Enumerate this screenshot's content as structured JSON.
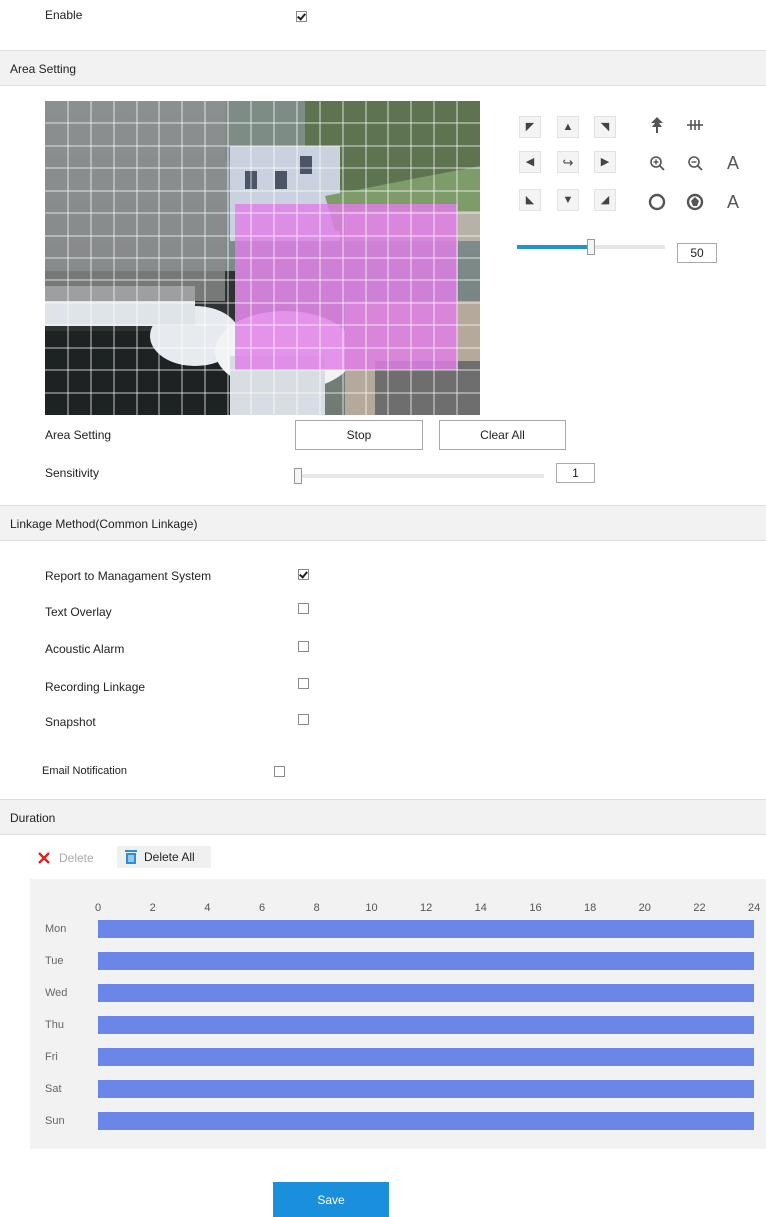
{
  "enable": {
    "label": "Enable",
    "checked": true
  },
  "area_section": {
    "title": "Area Setting"
  },
  "ptz": {
    "icons": [
      "arrow-up-left-icon",
      "arrow-up-icon",
      "arrow-up-right-icon",
      "arrow-left-icon",
      "rotate-icon",
      "arrow-right-icon",
      "arrow-down-left-icon",
      "arrow-down-icon",
      "arrow-down-right-icon",
      "focus-far-icon",
      "focus-near-icon",
      "zoom-in-icon",
      "zoom-out-icon",
      "auto-zoom-icon",
      "iris-close-icon",
      "iris-open-icon",
      "auto-iris-icon"
    ],
    "auto_label": "A",
    "speed_value": "50",
    "speed_fraction": 0.5
  },
  "area_setting": {
    "label": "Area Setting",
    "stop_button": "Stop",
    "clear_all_button": "Clear All"
  },
  "sensitivity": {
    "label": "Sensitivity",
    "value": "1",
    "fraction": 0.0
  },
  "linkage_section": {
    "title": "Linkage Method(Common Linkage)"
  },
  "linkage": [
    {
      "label": "Report to Managament System",
      "checked": true
    },
    {
      "label": "Text Overlay",
      "checked": false
    },
    {
      "label": "Acoustic Alarm",
      "checked": false
    },
    {
      "label": "Recording Linkage",
      "checked": false
    },
    {
      "label": "Snapshot",
      "checked": false
    }
  ],
  "email": {
    "label": "Email Notification",
    "checked": false
  },
  "duration_section": {
    "title": "Duration"
  },
  "toolbar": {
    "delete_label": "Delete",
    "delete_all_label": "Delete All"
  },
  "schedule": {
    "hours": [
      "0",
      "2",
      "4",
      "6",
      "8",
      "10",
      "12",
      "14",
      "16",
      "18",
      "20",
      "22",
      "24"
    ],
    "days": [
      "Mon",
      "Tue",
      "Wed",
      "Thu",
      "Fri",
      "Sat",
      "Sun"
    ],
    "coverage": [
      [
        0,
        24
      ],
      [
        0,
        24
      ],
      [
        0,
        24
      ],
      [
        0,
        24
      ],
      [
        0,
        24
      ],
      [
        0,
        24
      ],
      [
        0,
        24
      ]
    ]
  },
  "save_button": "Save",
  "colors": {
    "accent": "#1a8fdc",
    "schedule_bar": "#6a86e6",
    "motion_overlay": "#e07ee8",
    "slider_fill": "#1f97c6"
  }
}
